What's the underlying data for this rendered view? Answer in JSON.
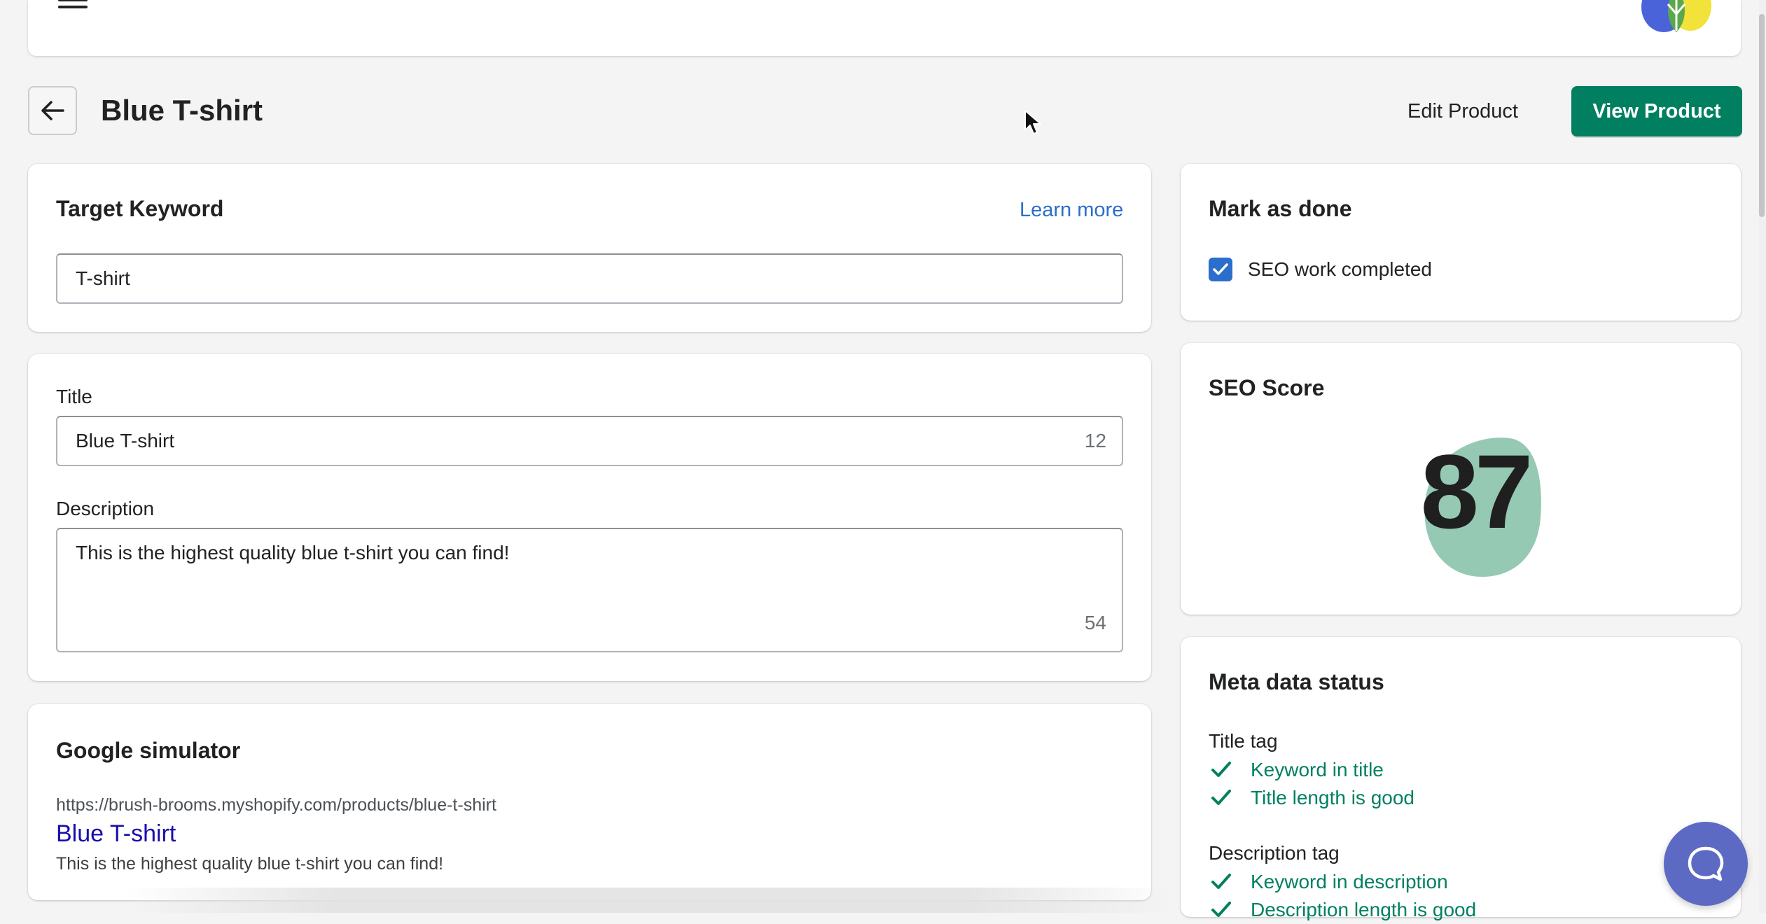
{
  "header": {
    "menu_icon": "hamburger-menu-icon",
    "logo_icon": "leaf-logo-icon",
    "logo_colors": [
      "#4a63d8",
      "#5aa84b",
      "#f2e23a"
    ]
  },
  "page": {
    "title": "Blue T-shirt",
    "back_icon": "arrow-left-icon",
    "edit_label": "Edit Product",
    "view_label": "View Product"
  },
  "target_keyword": {
    "title": "Target Keyword",
    "learn_more": "Learn more",
    "value": "T-shirt"
  },
  "meta": {
    "title_label": "Title",
    "title_value": "Blue T-shirt",
    "title_count": "12",
    "description_label": "Description",
    "description_value": "This is the highest quality blue t-shirt you can find!",
    "description_count": "54"
  },
  "google_simulator": {
    "title": "Google simulator",
    "url": "https://brush-brooms.myshopify.com/products/blue-t-shirt",
    "link_title": "Blue T-shirt",
    "description": "This is the highest quality blue t-shirt you can find!"
  },
  "mark_done": {
    "title": "Mark as done",
    "checkbox_label": "SEO work completed",
    "checked": true
  },
  "seo_score": {
    "title": "SEO Score",
    "value": "87",
    "blob_color": "#95c9b4"
  },
  "meta_status": {
    "title": "Meta data status",
    "title_tag": {
      "label": "Title tag",
      "checks": [
        "Keyword in title",
        "Title length is good"
      ]
    },
    "description_tag": {
      "label": "Description tag",
      "checks": [
        "Keyword in description",
        "Description length is good"
      ]
    }
  },
  "chat": {
    "icon": "chat-bubble-icon"
  },
  "colors": {
    "primary": "#008060",
    "link": "#2c6ecb",
    "chat": "#5c6ac4"
  }
}
